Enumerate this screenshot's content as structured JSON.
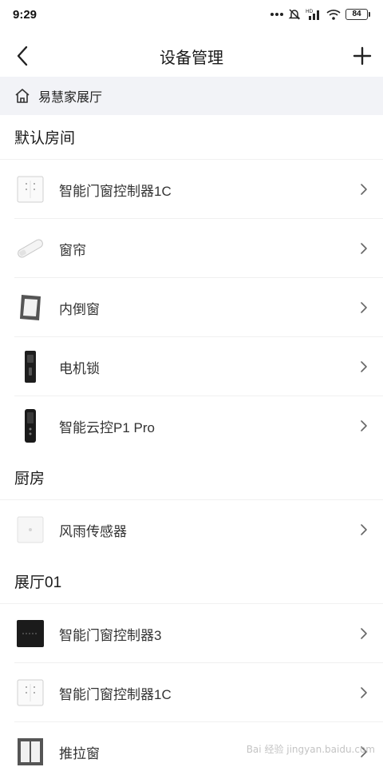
{
  "status_bar": {
    "time": "9:29",
    "battery": "84"
  },
  "header": {
    "title": "设备管理",
    "back_icon": "chevron-left-icon",
    "add_icon": "plus-icon"
  },
  "home": {
    "label": "易慧家展厅",
    "icon": "home-icon"
  },
  "rooms": [
    {
      "name": "默认房间",
      "devices": [
        {
          "label": "智能门窗控制器1C",
          "icon": "controller-white-icon"
        },
        {
          "label": "窗帘",
          "icon": "curtain-motor-icon"
        },
        {
          "label": "内倒窗",
          "icon": "tilt-window-icon"
        },
        {
          "label": "电机锁",
          "icon": "motor-lock-icon"
        },
        {
          "label": "智能云控P1 Pro",
          "icon": "cloud-controller-icon"
        }
      ]
    },
    {
      "name": "厨房",
      "devices": [
        {
          "label": "风雨传感器",
          "icon": "wind-rain-sensor-icon"
        }
      ]
    },
    {
      "name": "展厅01",
      "devices": [
        {
          "label": "智能门窗控制器3",
          "icon": "controller-black-icon"
        },
        {
          "label": "智能门窗控制器1C",
          "icon": "controller-white-icon"
        },
        {
          "label": "推拉窗",
          "icon": "sliding-window-icon"
        }
      ]
    }
  ],
  "watermark": "Bai 经验 jingyan.baidu.com"
}
